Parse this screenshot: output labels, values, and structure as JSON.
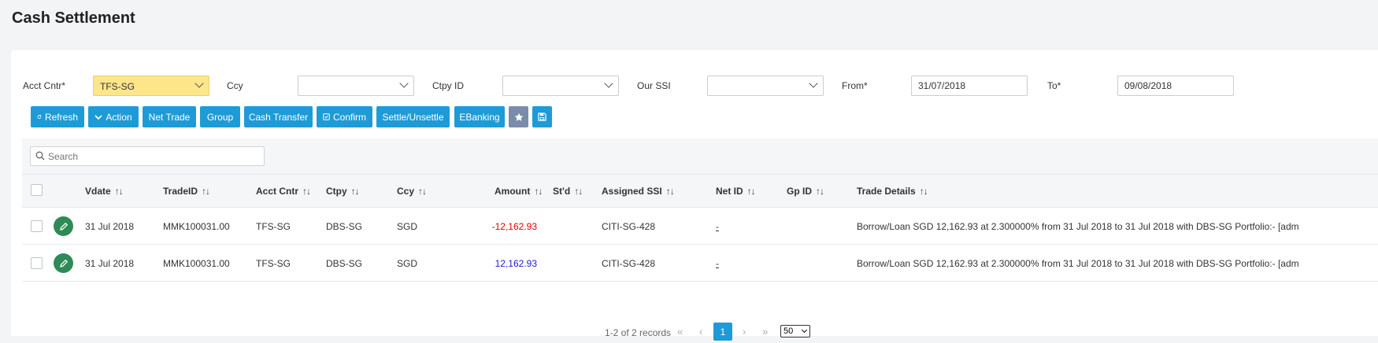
{
  "page": {
    "title": "Cash Settlement"
  },
  "filters": {
    "acct_cntr": {
      "label": "Acct Cntr*",
      "value": "TFS-SG"
    },
    "ccy": {
      "label": "Ccy",
      "value": ""
    },
    "ctpy_id": {
      "label": "Ctpy ID",
      "value": ""
    },
    "our_ssi": {
      "label": "Our SSI",
      "value": ""
    },
    "from": {
      "label": "From*",
      "value": "31/07/2018"
    },
    "to": {
      "label": "To*",
      "value": "09/08/2018"
    }
  },
  "toolbar": {
    "refresh": "Refresh",
    "action": "Action",
    "net_trade": "Net Trade",
    "group": "Group",
    "cash_transfer": "Cash Transfer",
    "confirm": "Confirm",
    "settle_unsettle": "Settle/Unsettle",
    "ebanking": "EBanking",
    "favorite_icon": "star-icon",
    "save_icon": "save-icon"
  },
  "grid": {
    "search_placeholder": "Search",
    "columns": [
      "Vdate",
      "TradeID",
      "Acct Cntr",
      "Ctpy",
      "Ccy",
      "Amount",
      "St'd",
      "Assigned SSI",
      "Net ID",
      "Gp ID",
      "Trade Details"
    ],
    "sort_glyph": "↑↓",
    "rows": [
      {
        "vdate": "31 Jul 2018",
        "trade_id": "MMK100031.00",
        "acct_cntr": "TFS-SG",
        "ctpy": "DBS-SG",
        "ccy": "SGD",
        "amount": "-12,162.93",
        "amount_sign": "negative",
        "stld": "",
        "assigned_ssi": "CITI-SG-428",
        "net_id": "-",
        "gp_id": "",
        "trade_details": "Borrow/Loan SGD 12,162.93 at 2.300000% from 31 Jul 2018 to 31 Jul 2018 with DBS-SG Portfolio:- [adm"
      },
      {
        "vdate": "31 Jul 2018",
        "trade_id": "MMK100031.00",
        "acct_cntr": "TFS-SG",
        "ctpy": "DBS-SG",
        "ccy": "SGD",
        "amount": "12,162.93",
        "amount_sign": "positive",
        "stld": "",
        "assigned_ssi": "CITI-SG-428",
        "net_id": "-",
        "gp_id": "",
        "trade_details": "Borrow/Loan SGD 12,162.93 at 2.300000% from 31 Jul 2018 to 31 Jul 2018 with DBS-SG Portfolio:- [adm"
      }
    ]
  },
  "pager": {
    "records": "1-2 of 2 records",
    "first": "«",
    "prev": "‹",
    "current_page": "1",
    "next": "›",
    "last": "»",
    "page_size": "50"
  },
  "colors": {
    "accent": "#1e9bd7",
    "highlight": "#fde68a",
    "negative": "#e00000",
    "positive": "#1a1ad6",
    "edit": "#2e8b57"
  }
}
